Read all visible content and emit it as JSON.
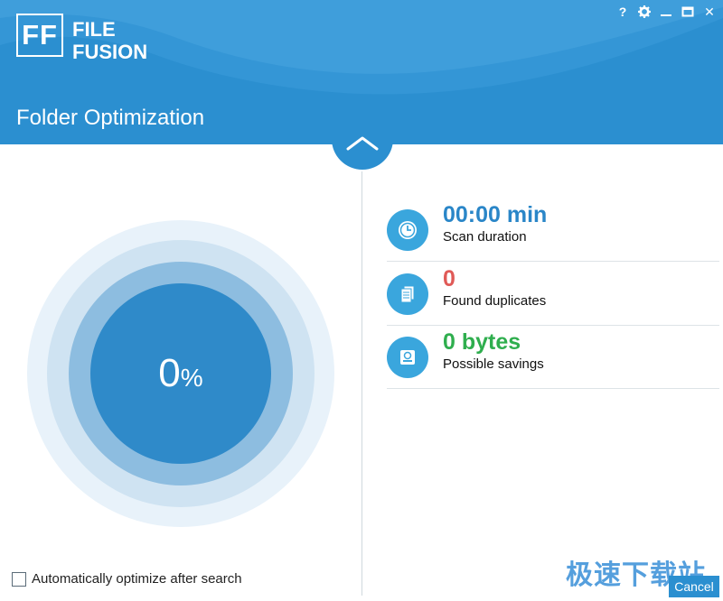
{
  "app": {
    "logo_letters": "FF",
    "logo_line1": "FILE",
    "logo_line2": "FUSION",
    "page_title": "Folder Optimization"
  },
  "window_controls": {
    "help": "?",
    "settings_icon": "gear-icon",
    "minimize_icon": "minimize-icon",
    "maximize_icon": "maximize-icon",
    "close": "✕"
  },
  "toggle": {
    "icon": "chevron-up-icon"
  },
  "progress": {
    "percent": 0,
    "value": "0",
    "unit": "%"
  },
  "stats": [
    {
      "icon": "clock-icon",
      "value": "00:00 min",
      "label": "Scan duration",
      "color": "#2a86c8"
    },
    {
      "icon": "documents-icon",
      "value": "0",
      "label": "Found duplicates",
      "color": "#e05a57"
    },
    {
      "icon": "drive-icon",
      "value": "0 bytes",
      "label": "Possible savings",
      "color": "#2fae4e"
    }
  ],
  "options": {
    "auto_optimize_label": "Automatically optimize after search",
    "auto_optimize_checked": false
  },
  "buttons": {
    "cancel": "Cancel"
  },
  "watermark": "极速下载站",
  "colors": {
    "brand_blue": "#2b8fd0",
    "accent_blue": "#3aa6dd",
    "red": "#e05a57",
    "green": "#2fae4e"
  }
}
